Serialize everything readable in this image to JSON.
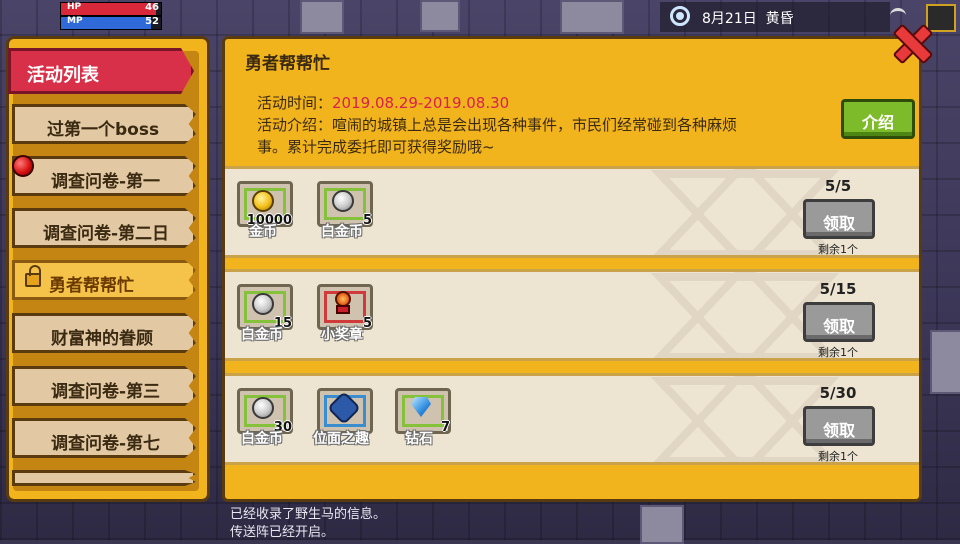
{
  "hud": {
    "hp_label": "HP",
    "hp_value": "46",
    "hp_fill": 0.95,
    "mp_label": "MP",
    "mp_value": "52",
    "mp_fill": 0.9,
    "date": "8月21日",
    "time_of_day": "黄昏"
  },
  "sidebar": {
    "header": "活动列表",
    "items": [
      {
        "label": "过第一个boss"
      },
      {
        "label": "调查问卷-第一"
      },
      {
        "label": "调查问卷-第二日"
      },
      {
        "label": "勇者帮帮忙"
      },
      {
        "label": "财富神的眷顾"
      },
      {
        "label": "调查问卷-第三"
      },
      {
        "label": "调查问卷-第七"
      }
    ]
  },
  "main": {
    "title": "勇者帮帮忙",
    "time_label": "活动时间：",
    "time_value": "2019.08.29-2019.08.30",
    "intro_line1": "活动介绍：喧闹的城镇上总是会出现各种事件，市民们经常碰到各种麻烦",
    "intro_line2": "事。累计完成委托即可获得奖励哦~",
    "intro_button": "介绍"
  },
  "rewards": [
    {
      "progress": "5/5",
      "claim_label": "领取",
      "remaining": "剩余1个",
      "items": [
        {
          "name": "金币",
          "count": "10000",
          "icon": "gold-coin-icon"
        },
        {
          "name": "白金币",
          "count": "5",
          "icon": "platinum-coin-icon"
        }
      ]
    },
    {
      "progress": "5/15",
      "claim_label": "领取",
      "remaining": "剩余1个",
      "items": [
        {
          "name": "白金币",
          "count": "15",
          "icon": "platinum-coin-icon"
        },
        {
          "name": "小奖章",
          "count": "5",
          "icon": "medal-icon"
        }
      ]
    },
    {
      "progress": "5/30",
      "claim_label": "领取",
      "remaining": "剩余1个",
      "items": [
        {
          "name": "白金币",
          "count": "30",
          "icon": "platinum-coin-icon"
        },
        {
          "name": "位面之趣",
          "count": "",
          "icon": "rune-icon"
        },
        {
          "name": "钻石",
          "count": "7",
          "icon": "diamond-icon"
        }
      ]
    }
  ],
  "log": {
    "line1": "已经收录了野生马的信息。",
    "line2": "传送阵已经开启。"
  },
  "colors": {
    "panel": "#f2b41d",
    "header_red": "#d9304a",
    "time_red": "#d9204a",
    "intro_green": "#7dbb2a",
    "claim_gray": "#9a9a9a"
  }
}
